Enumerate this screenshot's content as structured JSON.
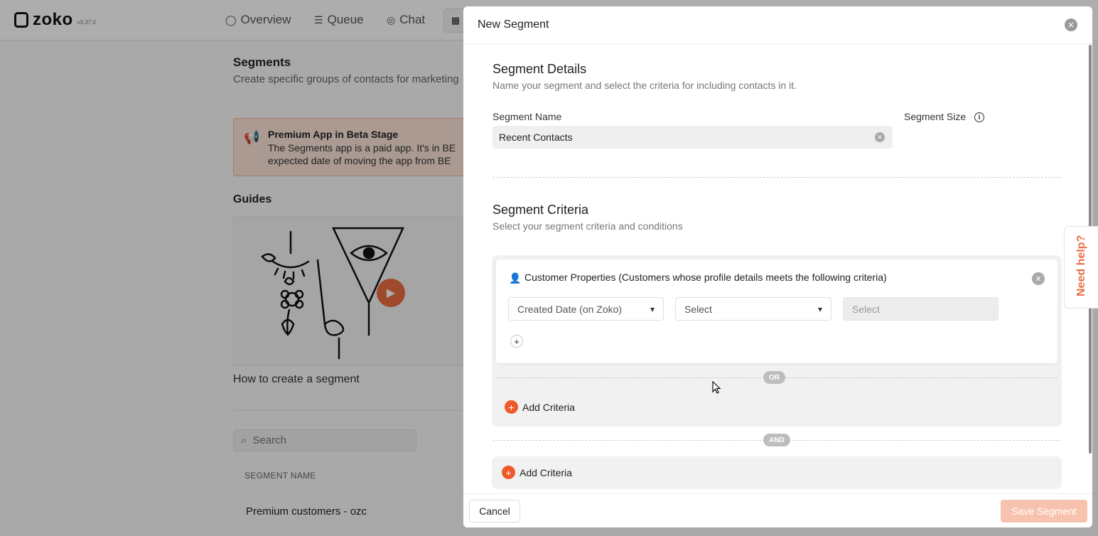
{
  "app": {
    "logo_text": "zoko",
    "version": "v3.37.0"
  },
  "nav": {
    "items": [
      {
        "label": "Overview",
        "icon": "circle-icon"
      },
      {
        "label": "Queue",
        "icon": "list-icon"
      },
      {
        "label": "Chat",
        "icon": "chat-icon"
      }
    ],
    "apps_icon": "grid-icon"
  },
  "page": {
    "title": "Segments",
    "subtitle": "Create specific groups of contacts for marketing",
    "beta": {
      "title": "Premium App in Beta Stage",
      "line1": "The Segments app is a paid app. It's in BE",
      "line2": "expected date of moving the app from BE"
    },
    "guides_title": "Guides",
    "video_caption": "How to create a segment",
    "search_placeholder": "Search",
    "table": {
      "column_header": "SEGMENT NAME",
      "rows": [
        "Premium customers - ozc"
      ]
    }
  },
  "modal": {
    "title": "New Segment",
    "details": {
      "title": "Segment Details",
      "subtitle": "Name your segment and select the criteria for including contacts in it.",
      "name_label": "Segment Name",
      "name_value": "Recent Contacts",
      "size_label": "Segment Size"
    },
    "criteria": {
      "title": "Segment Criteria",
      "subtitle": "Select your segment criteria and conditions",
      "group": {
        "label": "Customer Properties (Customers whose profile details meets the following criteria)",
        "property_select": "Created Date (on Zoko)",
        "operator_select": "Select",
        "value_select": "Select"
      },
      "or_label": "OR",
      "and_label": "AND",
      "add_criteria": "Add Criteria",
      "add_criteria_2": "Add Criteria"
    },
    "footer": {
      "cancel": "Cancel",
      "save": "Save Segment"
    }
  },
  "help": {
    "label": "Need help?"
  },
  "colors": {
    "accent": "#ef5a2a",
    "beta_bg": "#fbe3d8",
    "save_disabled": "#f8c3ae"
  }
}
